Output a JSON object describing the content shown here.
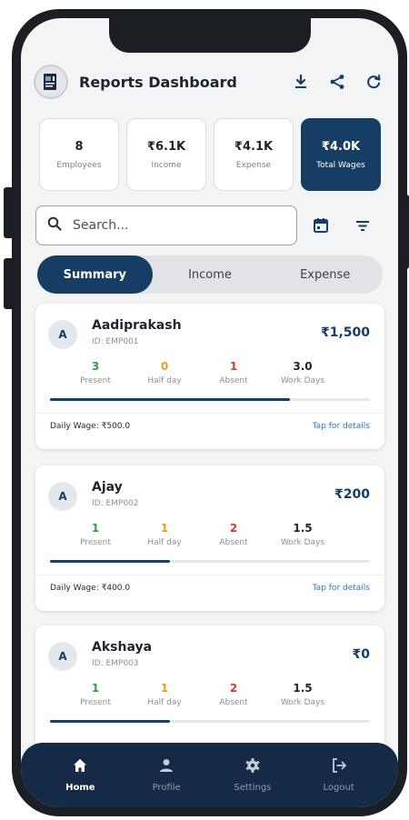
{
  "header": {
    "title": "Reports Dashboard",
    "icons": [
      "download-icon",
      "share-icon",
      "refresh-icon"
    ]
  },
  "stats": [
    {
      "value": "8",
      "label": "Employees"
    },
    {
      "value": "₹6.1K",
      "label": "Income"
    },
    {
      "value": "₹4.1K",
      "label": "Expense"
    },
    {
      "value": "₹4.0K",
      "label": "Total Wages"
    }
  ],
  "search": {
    "placeholder": "Search..."
  },
  "tabs": [
    "Summary",
    "Income",
    "Expense"
  ],
  "metric_labels": {
    "present": "Present",
    "half": "Half day",
    "absent": "Absent",
    "work": "Work Days"
  },
  "employees": [
    {
      "initial": "A",
      "name": "Aadiprakash",
      "id": "ID: EMP001",
      "amount": "₹1,500",
      "present": "3",
      "half": "0",
      "absent": "1",
      "work": "3.0",
      "progress": 0.75,
      "wage": "Daily Wage: ₹500.0",
      "details": "Tap for details"
    },
    {
      "initial": "A",
      "name": "Ajay",
      "id": "ID: EMP002",
      "amount": "₹200",
      "present": "1",
      "half": "1",
      "absent": "2",
      "work": "1.5",
      "progress": 0.375,
      "wage": "Daily Wage: ₹400.0",
      "details": "Tap for details"
    },
    {
      "initial": "A",
      "name": "Akshaya",
      "id": "ID: EMP003",
      "amount": "₹0",
      "present": "1",
      "half": "1",
      "absent": "2",
      "work": "1.5",
      "progress": 0.375,
      "wage": "",
      "details": ""
    }
  ],
  "nav": [
    {
      "label": "Home",
      "icon": "home-icon"
    },
    {
      "label": "Profile",
      "icon": "person-icon"
    },
    {
      "label": "Settings",
      "icon": "gear-icon"
    },
    {
      "label": "Logout",
      "icon": "logout-icon"
    }
  ],
  "colors": {
    "primary": "#163d63",
    "nav_bg": "#152a47",
    "present": "#3a9a45",
    "half": "#e0a020",
    "absent": "#d23b30",
    "link": "#2f7ab8"
  }
}
